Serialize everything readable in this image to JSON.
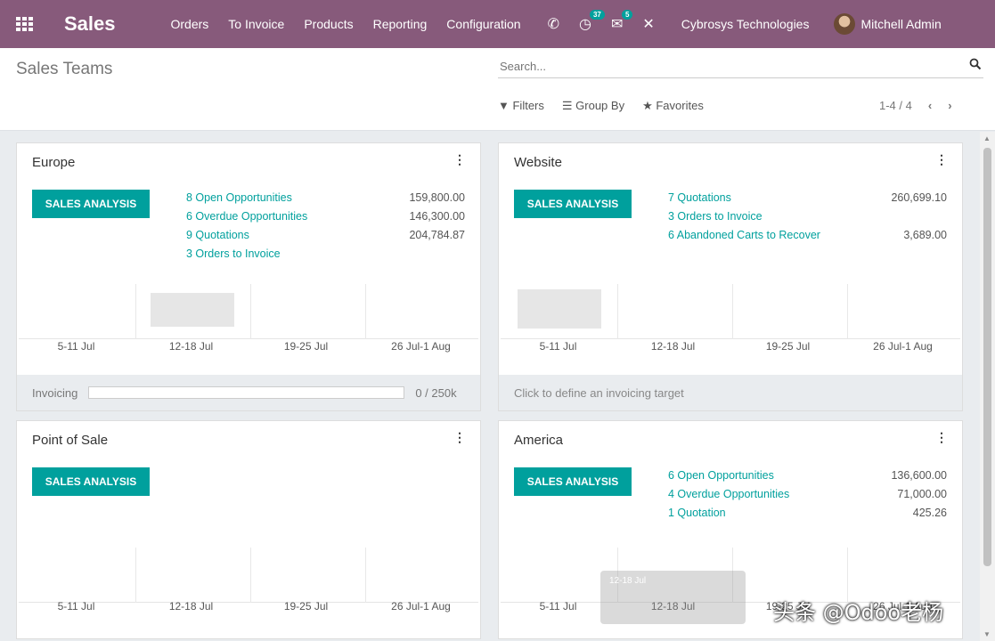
{
  "navbar": {
    "app_name": "Sales",
    "menu": [
      "Orders",
      "To Invoice",
      "Products",
      "Reporting",
      "Configuration"
    ],
    "activity_count": "37",
    "messages_count": "5",
    "company": "Cybrosys Technologies",
    "user": "Mitchell Admin"
  },
  "control": {
    "title": "Sales Teams",
    "search_placeholder": "Search...",
    "filters_label": "Filters",
    "groupby_label": "Group By",
    "favorites_label": "Favorites",
    "pager": "1-4 / 4"
  },
  "cards": [
    {
      "title": "Europe",
      "button": "SALES ANALYSIS",
      "stats": [
        {
          "label": "8 Open Opportunities",
          "value": "159,800.00"
        },
        {
          "label": "6 Overdue Opportunities",
          "value": "146,300.00"
        },
        {
          "label": "9 Quotations",
          "value": "204,784.87"
        },
        {
          "label": "3 Orders to Invoice",
          "value": ""
        }
      ],
      "ticks": [
        "5-11 Jul",
        "12-18 Jul",
        "19-25 Jul",
        "26 Jul-1 Aug"
      ],
      "footer_label": "Invoicing",
      "footer_value": "0 / 250k",
      "invoicing_progress": 0
    },
    {
      "title": "Website",
      "button": "SALES ANALYSIS",
      "stats": [
        {
          "label": "7 Quotations",
          "value": "260,699.10"
        },
        {
          "label": "3 Orders to Invoice",
          "value": ""
        },
        {
          "label": "6 Abandoned Carts to Recover",
          "value": "3,689.00"
        }
      ],
      "ticks": [
        "5-11 Jul",
        "12-18 Jul",
        "19-25 Jul",
        "26 Jul-1 Aug"
      ],
      "footer_link": "Click to define an invoicing target"
    },
    {
      "title": "Point of Sale",
      "button": "SALES ANALYSIS",
      "stats": [],
      "ticks": [
        "5-11 Jul",
        "12-18 Jul",
        "19-25 Jul",
        "26 Jul-1 Aug"
      ]
    },
    {
      "title": "America",
      "button": "SALES ANALYSIS",
      "stats": [
        {
          "label": "6 Open Opportunities",
          "value": "136,600.00"
        },
        {
          "label": "4 Overdue Opportunities",
          "value": "71,000.00"
        },
        {
          "label": "1 Quotation",
          "value": "425.26"
        }
      ],
      "ticks": [
        "5-11 Jul",
        "12-18 Jul",
        "19-25 Jul",
        "26 Jul-1 Aug"
      ]
    }
  ],
  "tooltip_text": "12-18 Jul",
  "watermark": "头条 @Odoo老杨",
  "colors": {
    "navbar": "#875a7b",
    "accent": "#00a09d"
  }
}
